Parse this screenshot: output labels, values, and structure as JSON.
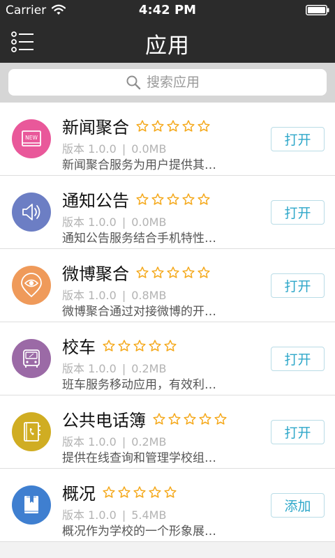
{
  "status_bar": {
    "carrier": "Carrier",
    "time": "4:42 PM",
    "icons": [
      "wifi-icon",
      "battery-icon"
    ]
  },
  "nav": {
    "title": "应用",
    "menu_icon": "menu-icon"
  },
  "search": {
    "placeholder": "搜索应用",
    "icon": "search-icon"
  },
  "colors": {
    "nav_bg": "#2b2b2b",
    "accent": "#2ea7c9",
    "star": "#f5a91c",
    "meta_text": "#b3b3b3"
  },
  "apps": [
    {
      "name": "新闻聚合",
      "version": "版本 1.0.0",
      "size": "0.0MB",
      "description": "新闻聚合服务为用户提供其…",
      "action": "打开",
      "rating": 0,
      "icon": "news-icon",
      "icon_color": "#e9589a"
    },
    {
      "name": "通知公告",
      "version": "版本 1.0.0",
      "size": "0.0MB",
      "description": "通知公告服务结合手机特性…",
      "action": "打开",
      "rating": 0,
      "icon": "speaker-icon",
      "icon_color": "#6c7ec4"
    },
    {
      "name": "微博聚合",
      "version": "版本 1.0.0",
      "size": "0.8MB",
      "description": "微博聚合通过对接微博的开…",
      "action": "打开",
      "rating": 0,
      "icon": "weibo-eye-icon",
      "icon_color": "#ef9a5a"
    },
    {
      "name": "校车",
      "version": "版本 1.0.0",
      "size": "0.2MB",
      "description": "班车服务移动应用，有效利…",
      "action": "打开",
      "rating": 0,
      "icon": "bus-icon",
      "icon_color": "#9b6aa6"
    },
    {
      "name": "公共电话簿",
      "version": "版本 1.0.0",
      "size": "0.2MB",
      "description": "提供在线查询和管理学校组…",
      "action": "打开",
      "rating": 0,
      "icon": "phonebook-icon",
      "icon_color": "#d0ad22"
    },
    {
      "name": "概况",
      "version": "版本 1.0.0",
      "size": "5.4MB",
      "description": "概况作为学校的一个形象展…",
      "action": "添加",
      "rating": 0,
      "icon": "book-icon",
      "icon_color": "#3f7fd0"
    }
  ]
}
